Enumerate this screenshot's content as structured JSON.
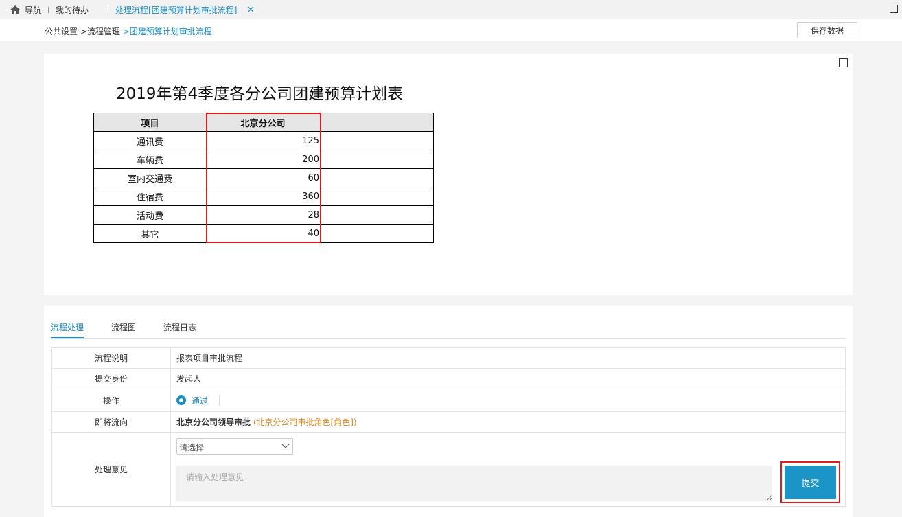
{
  "topbar": {
    "nav_label": "导航",
    "todo_label": "我的待办",
    "active_tab_label": "处理流程[团建预算计划审批流程]",
    "close_glyph": "×"
  },
  "breadcrumb": {
    "part1": "公共设置",
    "sep1": " >",
    "part2": "流程管理",
    "sep2": " >",
    "current": "团建预算计划审批流程"
  },
  "save_button_label": "保存数据",
  "report": {
    "title": "2019年第4季度各分公司团建预算计划表",
    "headers": [
      "项目",
      "北京分公司",
      ""
    ],
    "rows": [
      {
        "item": "通讯费",
        "value": "125"
      },
      {
        "item": "车辆费",
        "value": "200"
      },
      {
        "item": "室内交通费",
        "value": "60"
      },
      {
        "item": "住宿费",
        "value": "360"
      },
      {
        "item": "活动费",
        "value": "28"
      },
      {
        "item": "其它",
        "value": "40"
      }
    ]
  },
  "process": {
    "tabs": [
      "流程处理",
      "流程图",
      "流程日志"
    ],
    "active_tab": 0,
    "desc_label": "流程说明",
    "desc_value": "报表项目审批流程",
    "identity_label": "提交身份",
    "identity_value": "发起人",
    "action_label": "操作",
    "action_value": "通过",
    "next_label": "即将流向",
    "next_value": "北京分公司领导审批",
    "next_role": "(北京分公司审批角色[角色])",
    "opinion_label": "处理意见",
    "select_value": "请选择",
    "opinion_placeholder": "请输入处理意见",
    "submit_label": "提交"
  },
  "colors": {
    "accent": "#1b8fc5",
    "highlight": "#e01b1b",
    "role": "#e08a1e"
  }
}
